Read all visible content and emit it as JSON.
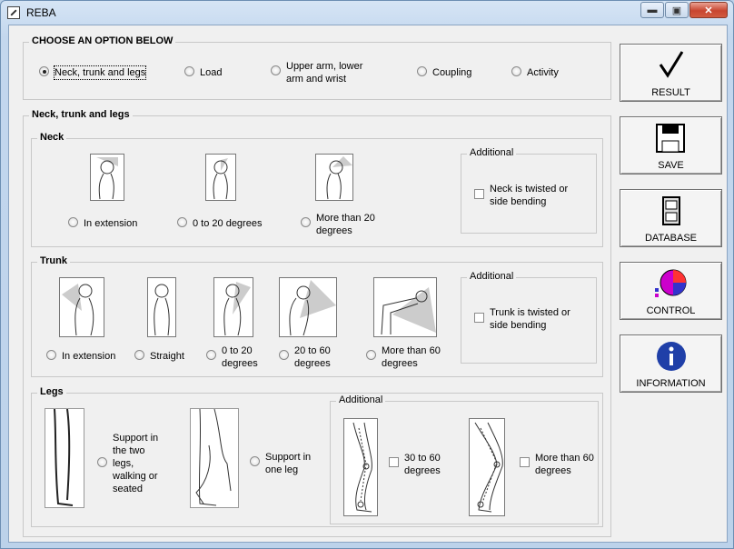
{
  "window": {
    "title": "REBA"
  },
  "options": {
    "title": "CHOOSE AN OPTION BELOW",
    "items": [
      "Neck, trunk and legs",
      "Load",
      "Upper arm, lower arm and wrist",
      "Coupling",
      "Activity"
    ],
    "selected": "Neck, trunk and legs"
  },
  "main_group": {
    "title": "Neck, trunk and legs"
  },
  "neck": {
    "title": "Neck",
    "radios": [
      "In extension",
      "0 to 20 degrees",
      "More than 20 degrees"
    ],
    "additional_title": "Additional",
    "additional_check": "Neck is twisted or side bending"
  },
  "trunk": {
    "title": "Trunk",
    "radios": [
      "In extension",
      "Straight",
      "0 to 20 degrees",
      "20 to 60 degrees",
      "More than 60 degrees"
    ],
    "additional_title": "Additional",
    "additional_check": "Trunk is twisted or side bending"
  },
  "legs": {
    "title": "Legs",
    "radios": [
      "Support in the two legs, walking or seated",
      "Support in one leg"
    ],
    "additional_title": "Additional",
    "additional_checks": [
      "30 to 60 degrees",
      "More than 60 degrees"
    ]
  },
  "side_buttons": {
    "result": "RESULT",
    "save": "SAVE",
    "database": "DATABASE",
    "control": "CONTROL",
    "information": "INFORMATION"
  },
  "icons": [
    "app-icon",
    "minimize-icon",
    "maximize-icon",
    "close-icon",
    "checkmark-icon",
    "floppy-disk-icon",
    "file-cabinet-icon",
    "pie-chart-icon",
    "info-icon"
  ]
}
